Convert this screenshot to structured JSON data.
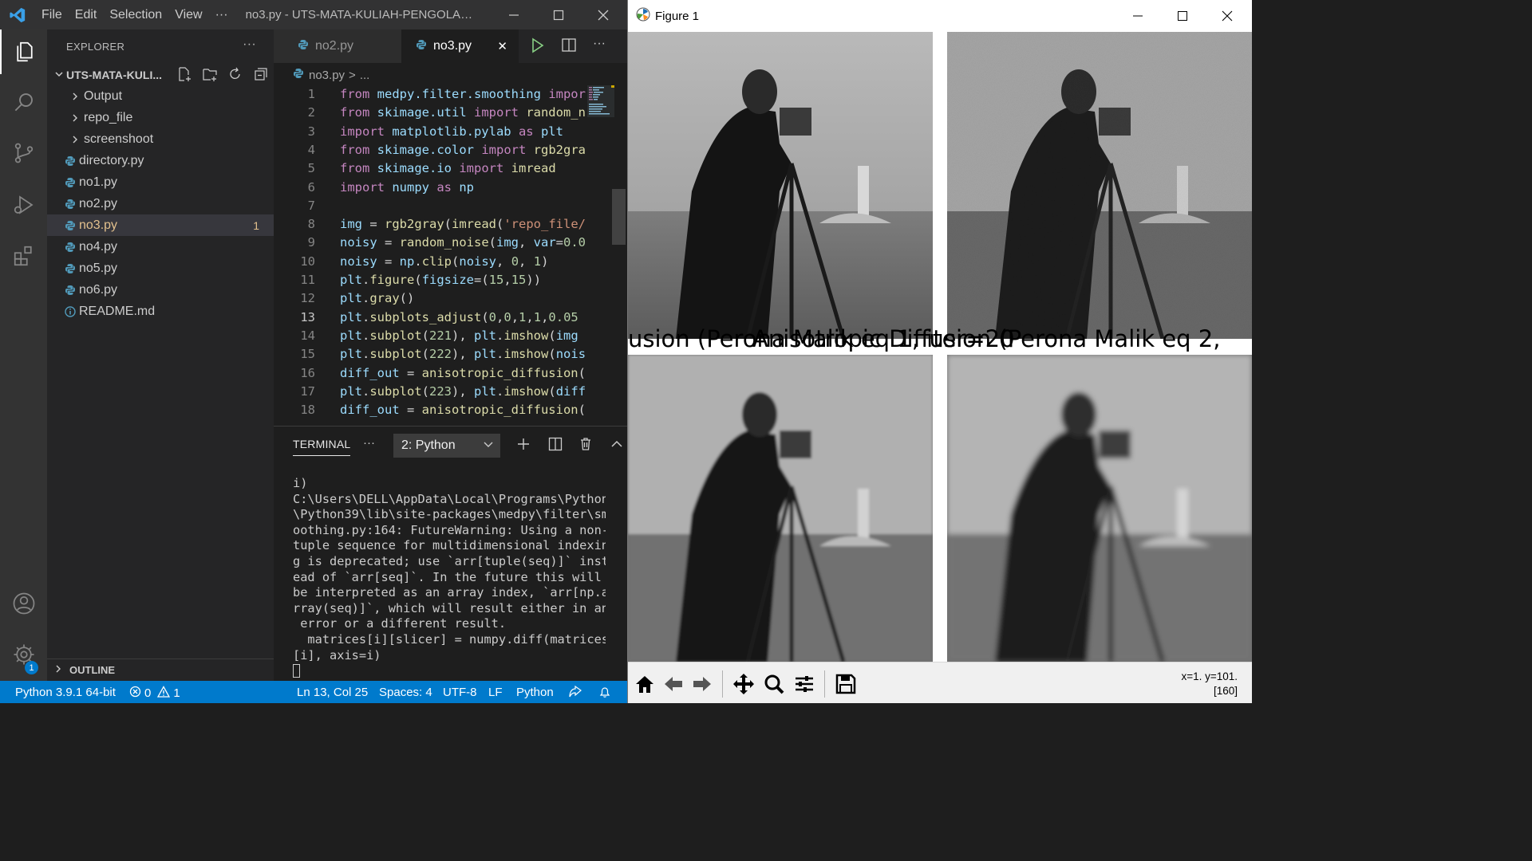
{
  "vscode": {
    "menu": [
      "File",
      "Edit",
      "Selection",
      "View"
    ],
    "menu_more": "···",
    "window_title": "no3.py - UTS-MATA-KULIAH-PENGOLAHA...",
    "explorer": {
      "header": "EXPLORER",
      "more": "···",
      "folder": "UTS-MATA-KULI...",
      "items": [
        {
          "label": "Output",
          "type": "folder"
        },
        {
          "label": "repo_file",
          "type": "folder"
        },
        {
          "label": "screenshoot",
          "type": "folder"
        },
        {
          "label": "directory.py",
          "type": "python"
        },
        {
          "label": "no1.py",
          "type": "python"
        },
        {
          "label": "no2.py",
          "type": "python"
        },
        {
          "label": "no3.py",
          "type": "python",
          "selected": true,
          "count": "1"
        },
        {
          "label": "no4.py",
          "type": "python"
        },
        {
          "label": "no5.py",
          "type": "python"
        },
        {
          "label": "no6.py",
          "type": "python"
        },
        {
          "label": "README.md",
          "type": "info"
        }
      ],
      "outline": "OUTLINE"
    },
    "activity_badge": "1",
    "tabs": [
      {
        "label": "no2.py",
        "active": false
      },
      {
        "label": "no3.py",
        "active": true
      }
    ],
    "tab_close": "✕",
    "breadcrumb": {
      "file": "no3.py",
      "sep": ">",
      "rest": "..."
    },
    "code": {
      "current_line": 13,
      "lines": [
        [
          {
            "t": "from ",
            "c": "kw"
          },
          {
            "t": "medpy.filter.smoothing",
            "c": "id"
          },
          {
            "t": " import",
            "c": "kw"
          }
        ],
        [
          {
            "t": "from ",
            "c": "kw"
          },
          {
            "t": "skimage.util",
            "c": "id"
          },
          {
            "t": " import ",
            "c": "kw"
          },
          {
            "t": "random_n",
            "c": "fn"
          }
        ],
        [
          {
            "t": "import ",
            "c": "kw"
          },
          {
            "t": "matplotlib.pylab",
            "c": "id"
          },
          {
            "t": " as ",
            "c": "kw"
          },
          {
            "t": "plt",
            "c": "id"
          }
        ],
        [
          {
            "t": "from ",
            "c": "kw"
          },
          {
            "t": "skimage.color",
            "c": "id"
          },
          {
            "t": " import ",
            "c": "kw"
          },
          {
            "t": "rgb2gra",
            "c": "fn"
          }
        ],
        [
          {
            "t": "from ",
            "c": "kw"
          },
          {
            "t": "skimage.io",
            "c": "id"
          },
          {
            "t": " import ",
            "c": "kw"
          },
          {
            "t": "imread",
            "c": "fn"
          }
        ],
        [
          {
            "t": "import ",
            "c": "kw"
          },
          {
            "t": "numpy",
            "c": "id"
          },
          {
            "t": " as ",
            "c": "kw"
          },
          {
            "t": "np",
            "c": "id"
          }
        ],
        [],
        [
          {
            "t": "img",
            "c": "id"
          },
          {
            "t": " = ",
            "c": "pl"
          },
          {
            "t": "rgb2gray",
            "c": "fn"
          },
          {
            "t": "(",
            "c": "pl"
          },
          {
            "t": "imread",
            "c": "fn"
          },
          {
            "t": "(",
            "c": "pl"
          },
          {
            "t": "'repo_file/",
            "c": "st"
          }
        ],
        [
          {
            "t": "noisy",
            "c": "id"
          },
          {
            "t": " = ",
            "c": "pl"
          },
          {
            "t": "random_noise",
            "c": "fn"
          },
          {
            "t": "(",
            "c": "pl"
          },
          {
            "t": "img",
            "c": "id"
          },
          {
            "t": ", ",
            "c": "pl"
          },
          {
            "t": "var",
            "c": "id"
          },
          {
            "t": "=",
            "c": "pl"
          },
          {
            "t": "0.0",
            "c": "nm"
          }
        ],
        [
          {
            "t": "noisy",
            "c": "id"
          },
          {
            "t": " = ",
            "c": "pl"
          },
          {
            "t": "np",
            "c": "id"
          },
          {
            "t": ".",
            "c": "pl"
          },
          {
            "t": "clip",
            "c": "fn"
          },
          {
            "t": "(",
            "c": "pl"
          },
          {
            "t": "noisy",
            "c": "id"
          },
          {
            "t": ", ",
            "c": "pl"
          },
          {
            "t": "0",
            "c": "nm"
          },
          {
            "t": ", ",
            "c": "pl"
          },
          {
            "t": "1",
            "c": "nm"
          },
          {
            "t": ")",
            "c": "pl"
          }
        ],
        [
          {
            "t": "plt",
            "c": "id"
          },
          {
            "t": ".",
            "c": "pl"
          },
          {
            "t": "figure",
            "c": "fn"
          },
          {
            "t": "(",
            "c": "pl"
          },
          {
            "t": "figsize",
            "c": "id"
          },
          {
            "t": "=(",
            "c": "pl"
          },
          {
            "t": "15",
            "c": "nm"
          },
          {
            "t": ",",
            "c": "pl"
          },
          {
            "t": "15",
            "c": "nm"
          },
          {
            "t": "))",
            "c": "pl"
          }
        ],
        [
          {
            "t": "plt",
            "c": "id"
          },
          {
            "t": ".",
            "c": "pl"
          },
          {
            "t": "gray",
            "c": "fn"
          },
          {
            "t": "()",
            "c": "pl"
          }
        ],
        [
          {
            "t": "plt",
            "c": "id"
          },
          {
            "t": ".",
            "c": "pl"
          },
          {
            "t": "subplots_adjust",
            "c": "fn"
          },
          {
            "t": "(",
            "c": "pl"
          },
          {
            "t": "0",
            "c": "nm"
          },
          {
            "t": ",",
            "c": "pl"
          },
          {
            "t": "0",
            "c": "nm"
          },
          {
            "t": ",",
            "c": "pl"
          },
          {
            "t": "1",
            "c": "nm"
          },
          {
            "t": ",",
            "c": "pl"
          },
          {
            "t": "1",
            "c": "nm"
          },
          {
            "t": ",",
            "c": "pl"
          },
          {
            "t": "0.05",
            "c": "nm"
          }
        ],
        [
          {
            "t": "plt",
            "c": "id"
          },
          {
            "t": ".",
            "c": "pl"
          },
          {
            "t": "subplot",
            "c": "fn"
          },
          {
            "t": "(",
            "c": "pl"
          },
          {
            "t": "221",
            "c": "nm"
          },
          {
            "t": "), ",
            "c": "pl"
          },
          {
            "t": "plt",
            "c": "id"
          },
          {
            "t": ".",
            "c": "pl"
          },
          {
            "t": "imshow",
            "c": "fn"
          },
          {
            "t": "(",
            "c": "pl"
          },
          {
            "t": "img",
            "c": "id"
          }
        ],
        [
          {
            "t": "plt",
            "c": "id"
          },
          {
            "t": ".",
            "c": "pl"
          },
          {
            "t": "subplot",
            "c": "fn"
          },
          {
            "t": "(",
            "c": "pl"
          },
          {
            "t": "222",
            "c": "nm"
          },
          {
            "t": "), ",
            "c": "pl"
          },
          {
            "t": "plt",
            "c": "id"
          },
          {
            "t": ".",
            "c": "pl"
          },
          {
            "t": "imshow",
            "c": "fn"
          },
          {
            "t": "(",
            "c": "pl"
          },
          {
            "t": "nois",
            "c": "id"
          }
        ],
        [
          {
            "t": "diff_out",
            "c": "id"
          },
          {
            "t": " = ",
            "c": "pl"
          },
          {
            "t": "anisotropic_diffusion",
            "c": "fn"
          },
          {
            "t": "(",
            "c": "pl"
          }
        ],
        [
          {
            "t": "plt",
            "c": "id"
          },
          {
            "t": ".",
            "c": "pl"
          },
          {
            "t": "subplot",
            "c": "fn"
          },
          {
            "t": "(",
            "c": "pl"
          },
          {
            "t": "223",
            "c": "nm"
          },
          {
            "t": "), ",
            "c": "pl"
          },
          {
            "t": "plt",
            "c": "id"
          },
          {
            "t": ".",
            "c": "pl"
          },
          {
            "t": "imshow",
            "c": "fn"
          },
          {
            "t": "(",
            "c": "pl"
          },
          {
            "t": "diff",
            "c": "id"
          }
        ],
        [
          {
            "t": "diff_out",
            "c": "id"
          },
          {
            "t": " = ",
            "c": "pl"
          },
          {
            "t": "anisotropic_diffusion",
            "c": "fn"
          },
          {
            "t": "(",
            "c": "pl"
          }
        ]
      ]
    },
    "terminal": {
      "tab": "TERMINAL",
      "more": "···",
      "selector": "2: Python",
      "lines": [
        "i)",
        "C:\\Users\\DELL\\AppData\\Local\\Programs\\Python",
        "\\Python39\\lib\\site-packages\\medpy\\filter\\sm",
        "oothing.py:164: FutureWarning: Using a non-",
        "tuple sequence for multidimensional indexin",
        "g is deprecated; use `arr[tuple(seq)]` inst",
        "ead of `arr[seq]`. In the future this will",
        "be interpreted as an array index, `arr[np.a",
        "rray(seq)]`, which will result either in an",
        " error or a different result.",
        "  matrices[i][slicer] = numpy.diff(matrices",
        "[i], axis=i)"
      ]
    },
    "status": {
      "interpreter": "Python 3.9.1 64-bit",
      "errors": "0",
      "warnings": "1",
      "position": "Ln 13, Col 25",
      "spaces": "Spaces: 4",
      "encoding": "UTF-8",
      "eol": "LF",
      "language": "Python"
    }
  },
  "figure": {
    "title": "Figure 1",
    "overlapping_titles": "usion (PeronaAnisMatikpeqDiffusion (Perona Malik eq 2,",
    "overlap_a": "usion (Perona Malik eq 1, iter=20",
    "overlap_b": "Anisotropic Diffusion (Perona Malik eq 2,",
    "coords_line1": "x=1. y=101.",
    "coords_line2": "[160]",
    "toolbar_icons": [
      "home-icon",
      "back-icon",
      "forward-icon",
      "pan-icon",
      "zoom-icon",
      "configure-icon",
      "save-icon"
    ]
  }
}
